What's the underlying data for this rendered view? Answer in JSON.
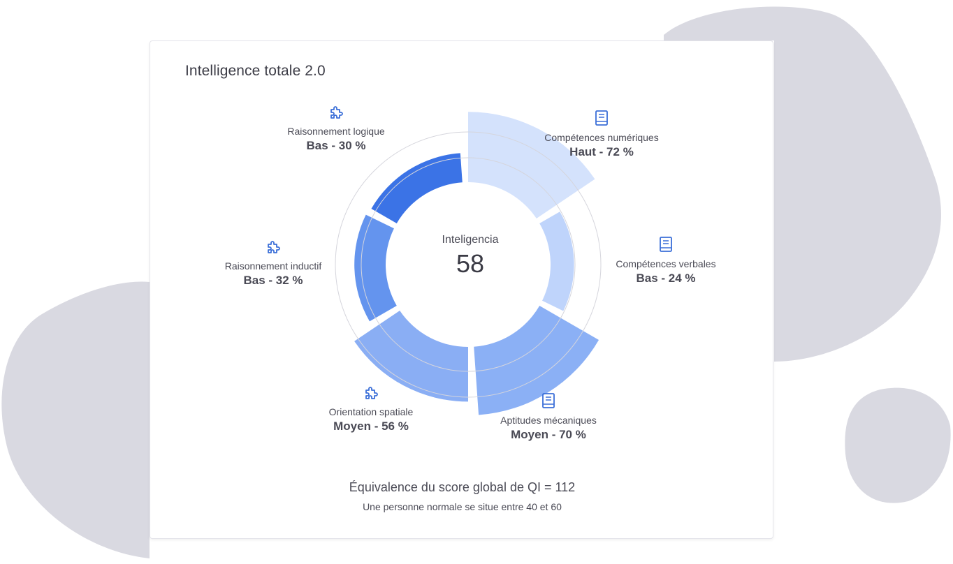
{
  "card": {
    "title": "Intelligence totale 2.0"
  },
  "center": {
    "label": "Inteligencia",
    "value": "58"
  },
  "footer": {
    "main": "Équivalence du score global de QI = 112",
    "sub": "Une personne normale se situe entre 40 et 60"
  },
  "colors": {
    "background_blob": "#d9d9e1",
    "ring": "#d5d5dc",
    "text": "#4a4a55",
    "icon": "#3b6fd8"
  },
  "chart_data": {
    "type": "radial-bar",
    "title": "Intelligence totale 2.0",
    "center_label": "Inteligencia",
    "center_value": 58,
    "categories": [
      {
        "name": "Raisonnement logique",
        "level": "Bas",
        "value": 30,
        "display": "Bas - 30 %",
        "icon": "puzzle-icon",
        "color": "#3b73e6"
      },
      {
        "name": "Compétences numériques",
        "level": "Haut",
        "value": 72,
        "display": "Haut - 72 %",
        "icon": "book-icon",
        "color": "#d4e2fc"
      },
      {
        "name": "Compétences verbales",
        "level": "Bas",
        "value": 24,
        "display": "Bas - 24 %",
        "icon": "book-icon",
        "color": "#bfd4fb"
      },
      {
        "name": "Aptitudes mécaniques",
        "level": "Moyen",
        "value": 70,
        "display": "Moyen - 70 %",
        "icon": "book-icon",
        "color": "#8bb0f5"
      },
      {
        "name": "Orientation spatiale",
        "level": "Moyen",
        "value": 56,
        "display": "Moyen - 56 %",
        "icon": "puzzle-icon",
        "color": "#8aaef4"
      },
      {
        "name": "Raisonnement inductif",
        "level": "Bas",
        "value": 32,
        "display": "Bas - 32 %",
        "icon": "puzzle-icon",
        "color": "#6494ee"
      }
    ]
  }
}
